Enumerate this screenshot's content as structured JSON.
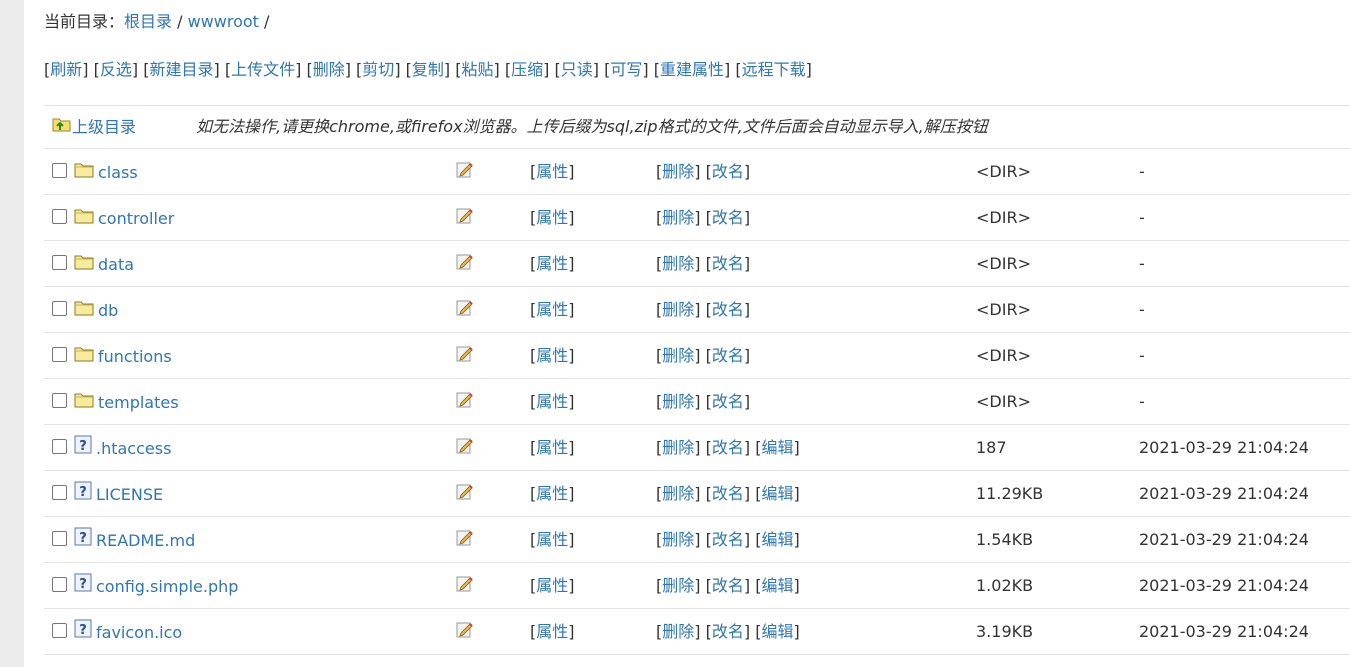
{
  "breadcrumb": {
    "label": "当前目录：",
    "root": "根目录",
    "sep1": " / ",
    "dir": "wwwroot",
    "sep2": " /"
  },
  "toolbar": [
    {
      "label": "刷新"
    },
    {
      "label": "反选"
    },
    {
      "label": "新建目录"
    },
    {
      "label": "上传文件"
    },
    {
      "label": "删除"
    },
    {
      "label": "剪切"
    },
    {
      "label": "复制"
    },
    {
      "label": "粘贴"
    },
    {
      "label": "压缩"
    },
    {
      "label": "只读"
    },
    {
      "label": "可写"
    },
    {
      "label": "重建属性"
    },
    {
      "label": "远程下载"
    }
  ],
  "parent": {
    "label": "上级目录",
    "icon": "folder-up-icon",
    "notice": "如无法操作,请更换chrome,或firefox浏览器。上传后缀为sql,zip格式的文件,文件后面会自动显示导入,解压按钮"
  },
  "labels": {
    "attr": "属性",
    "delete": "删除",
    "rename": "改名",
    "edit": "编辑"
  },
  "files": [
    {
      "name": "class",
      "type": "dir",
      "size": "<DIR>",
      "time": "-"
    },
    {
      "name": "controller",
      "type": "dir",
      "size": "<DIR>",
      "time": "-"
    },
    {
      "name": "data",
      "type": "dir",
      "size": "<DIR>",
      "time": "-"
    },
    {
      "name": "db",
      "type": "dir",
      "size": "<DIR>",
      "time": "-"
    },
    {
      "name": "functions",
      "type": "dir",
      "size": "<DIR>",
      "time": "-"
    },
    {
      "name": "templates",
      "type": "dir",
      "size": "<DIR>",
      "time": "-"
    },
    {
      "name": ".htaccess",
      "type": "file",
      "size": "187",
      "time": "2021-03-29 21:04:24"
    },
    {
      "name": "LICENSE",
      "type": "file",
      "size": "11.29KB",
      "time": "2021-03-29 21:04:24"
    },
    {
      "name": "README.md",
      "type": "file",
      "size": "1.54KB",
      "time": "2021-03-29 21:04:24"
    },
    {
      "name": "config.simple.php",
      "type": "file",
      "size": "1.02KB",
      "time": "2021-03-29 21:04:24"
    },
    {
      "name": "favicon.ico",
      "type": "file",
      "size": "3.19KB",
      "time": "2021-03-29 21:04:24"
    }
  ],
  "colors": {
    "link": "#2e76b6",
    "border": "#e3e3e3",
    "folder": "#f5e68a"
  }
}
